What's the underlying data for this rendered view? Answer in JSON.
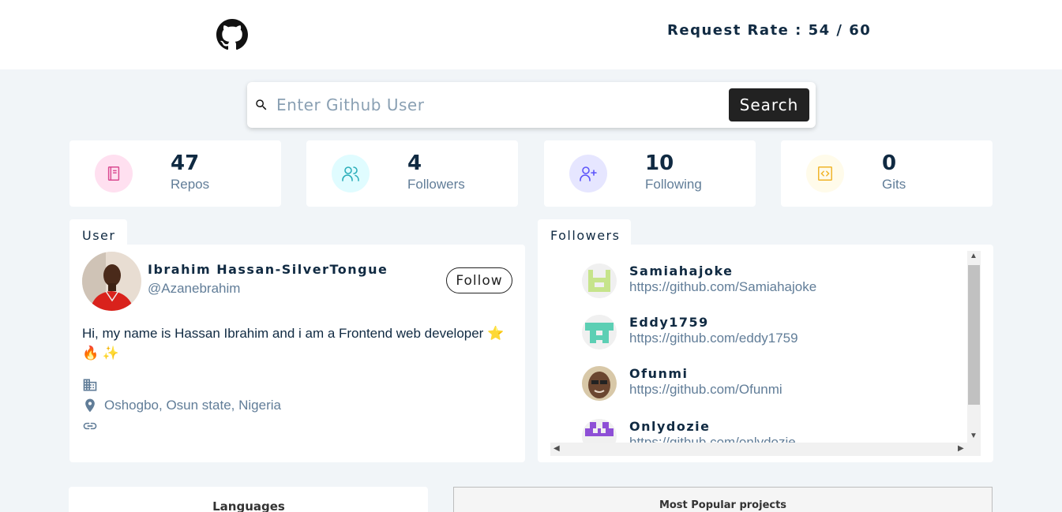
{
  "header": {
    "logo_icon": "github-icon",
    "request_rate": "Request Rate : 54 / 60"
  },
  "search": {
    "placeholder": "Enter Github User",
    "value": "",
    "button_label": "Search",
    "icon": "search-icon"
  },
  "stats": [
    {
      "value": "47",
      "label": "Repos",
      "icon": "book-icon",
      "color": "#da4a91",
      "bg": "#ffe0f0"
    },
    {
      "value": "4",
      "label": "Followers",
      "icon": "users-icon",
      "color": "#2caeba",
      "bg": "#e0fcff"
    },
    {
      "value": "10",
      "label": "Following",
      "icon": "user-plus-icon",
      "color": "#5d55fa",
      "bg": "#e6e6ff"
    },
    {
      "value": "0",
      "label": "Gits",
      "icon": "code-icon",
      "color": "#f0b429",
      "bg": "#fffbea"
    }
  ],
  "user_card": {
    "tab_label": "User",
    "name": "Ibrahim Hassan-SilverTongue",
    "login": "@Azanebrahim",
    "follow_label": "Follow",
    "bio": "Hi, my name is Hassan Ibrahim and i am a Frontend web developer ⭐ 🔥 ✨",
    "company": "",
    "location": "Oshogbo, Osun state, Nigeria",
    "blog": ""
  },
  "followers_card": {
    "tab_label": "Followers",
    "items": [
      {
        "name": "Samiahajoke",
        "url": "https://github.com/Samiahajoke"
      },
      {
        "name": "Eddy1759",
        "url": "https://github.com/eddy1759"
      },
      {
        "name": "Ofunmi",
        "url": "https://github.com/Ofunmi"
      },
      {
        "name": "Onlydozie",
        "url": "https://github.com/onlydozie"
      }
    ]
  },
  "languages": {
    "title": "Languages"
  },
  "popular": {
    "title": "Most Popular projects"
  }
}
